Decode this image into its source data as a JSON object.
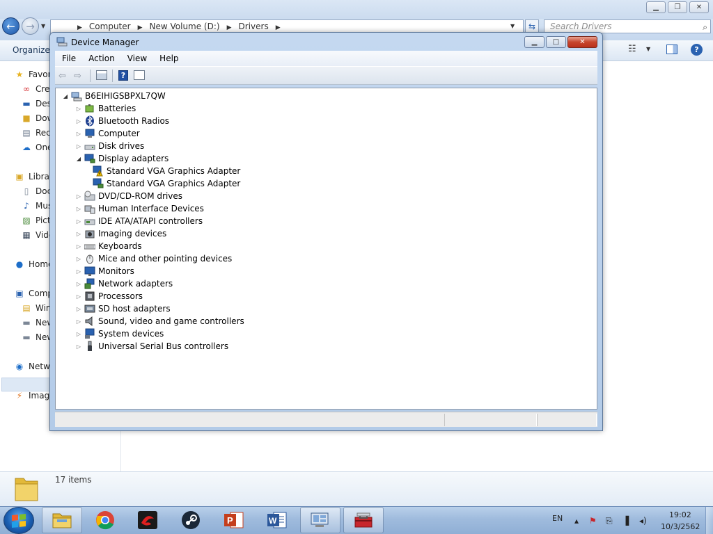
{
  "explorer": {
    "address_crumbs": [
      "Computer",
      "New Volume (D:)",
      "Drivers"
    ],
    "search_placeholder": "Search Drivers",
    "toolbar": {
      "organize_label": "Organize"
    },
    "nav": {
      "favorites": "Favor",
      "creative": "Crea",
      "desktop": "Des",
      "downloads": "Dow",
      "recent": "Rec",
      "onedrive": "One",
      "libraries": "Libra",
      "documents": "Doc",
      "music": "Mus",
      "pictures": "Pict",
      "videos": "Vide",
      "homegroup": "Home",
      "computer": "Comp",
      "windows": "Win",
      "new_volume_1": "New",
      "new_volume_2": "New",
      "network": "Netw",
      "image": "Image"
    },
    "status_items": "17 items"
  },
  "device_manager": {
    "title": "Device Manager",
    "menu": [
      "File",
      "Action",
      "View",
      "Help"
    ],
    "root": "B6EIHIGSBPXL7QW",
    "categories": {
      "batteries": "Batteries",
      "bluetooth": "Bluetooth Radios",
      "computer": "Computer",
      "disk": "Disk drives",
      "display": "Display adapters",
      "vga1": "Standard VGA Graphics Adapter",
      "vga2": "Standard VGA Graphics Adapter",
      "dvd": "DVD/CD-ROM drives",
      "hid": "Human Interface Devices",
      "ide": "IDE ATA/ATAPI controllers",
      "imaging": "Imaging devices",
      "keyboards": "Keyboards",
      "mice": "Mice and other pointing devices",
      "monitors": "Monitors",
      "network": "Network adapters",
      "processors": "Processors",
      "sdhost": "SD host adapters",
      "sound": "Sound, video and game controllers",
      "system": "System devices",
      "usb": "Universal Serial Bus controllers"
    }
  },
  "taskbar": {
    "language": "EN",
    "time": "19:02",
    "date": "10/3/2562"
  },
  "colors": {
    "window_frame": "#b3cbe8",
    "close_button": "#c7452d",
    "taskbar": "#9fbbdd",
    "warning_badge": "#f2c200"
  }
}
